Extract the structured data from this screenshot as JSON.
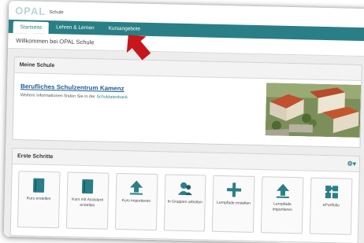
{
  "header": {
    "logo": "OPAL",
    "logo_sub": "Schule"
  },
  "nav": {
    "tabs": [
      {
        "label": "Startseite",
        "active": true
      },
      {
        "label": "Lehren & Lernen",
        "active": false
      },
      {
        "label": "Kursangebote",
        "active": false
      }
    ]
  },
  "welcome_text": "Willkommen bei OPAL Schule",
  "school_panel": {
    "title": "Meine Schule",
    "school_name": "Berufliches Schulzentrum Kamenz",
    "info_text": "Weitere Informationen finden Sie in der",
    "info_link": "Schuldatenbank"
  },
  "steps_panel": {
    "title": "Erste Schritte",
    "tiles": [
      {
        "label": "Kurs erstellen",
        "icon": "book-icon"
      },
      {
        "label": "Kurs mit Assistent erstellen",
        "icon": "book-assistant-icon"
      },
      {
        "label": "Kurs importieren",
        "icon": "upload-icon"
      },
      {
        "label": "In Gruppen arbeiten",
        "icon": "group-icon"
      },
      {
        "label": "Lernpfade erstellen",
        "icon": "plus-icon"
      },
      {
        "label": "Lernpfade importieren",
        "icon": "upload-icon"
      },
      {
        "label": "ePortfolio",
        "icon": "puzzle-icon"
      }
    ]
  },
  "colors": {
    "accent": "#2a7f86",
    "arrow": "#c8161d",
    "link": "#1f5c96"
  }
}
